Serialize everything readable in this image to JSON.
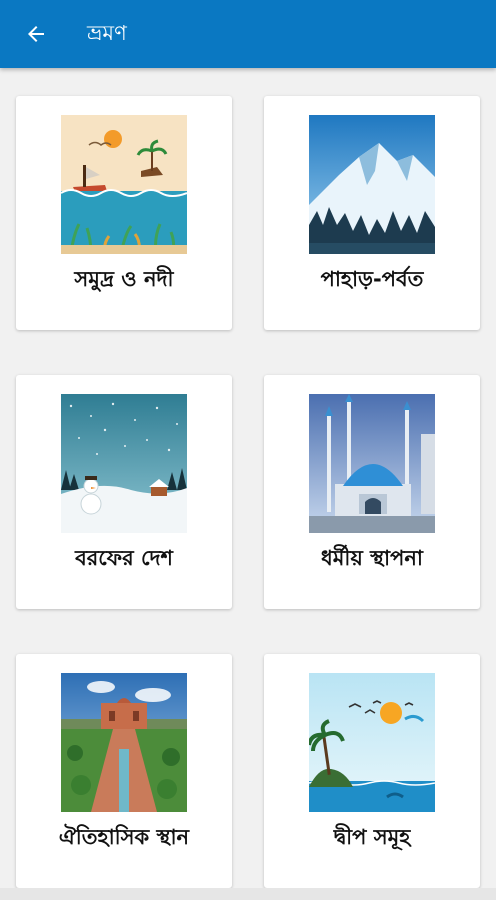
{
  "appbar": {
    "title": "ভ্রমণ",
    "back_icon": "arrow-left-icon",
    "color": "#0a78c2"
  },
  "categories": [
    {
      "label": "সমুদ্র ও নদী",
      "icon": "sea-river-image"
    },
    {
      "label": "পাহাড়-পর্বত",
      "icon": "mountain-image"
    },
    {
      "label": "বরফের দেশ",
      "icon": "snow-country-image"
    },
    {
      "label": "ধর্মীয় স্থাপনা",
      "icon": "religious-building-image"
    },
    {
      "label": "ঐতিহাসিক স্থান",
      "icon": "historical-place-image"
    },
    {
      "label": "দ্বীপ সমূহ",
      "icon": "island-image"
    }
  ]
}
